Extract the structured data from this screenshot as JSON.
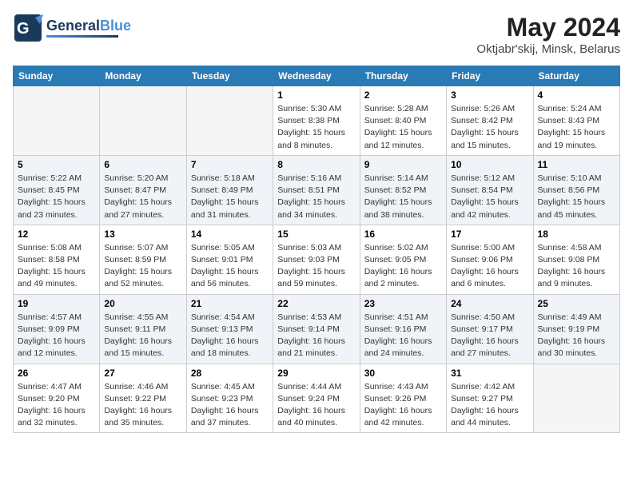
{
  "header": {
    "logo_line1": "General",
    "logo_line2": "Blue",
    "month_year": "May 2024",
    "location": "Oktjabr'skij, Minsk, Belarus"
  },
  "weekdays": [
    "Sunday",
    "Monday",
    "Tuesday",
    "Wednesday",
    "Thursday",
    "Friday",
    "Saturday"
  ],
  "weeks": [
    [
      {
        "day": "",
        "info": ""
      },
      {
        "day": "",
        "info": ""
      },
      {
        "day": "",
        "info": ""
      },
      {
        "day": "1",
        "info": "Sunrise: 5:30 AM\nSunset: 8:38 PM\nDaylight: 15 hours\nand 8 minutes."
      },
      {
        "day": "2",
        "info": "Sunrise: 5:28 AM\nSunset: 8:40 PM\nDaylight: 15 hours\nand 12 minutes."
      },
      {
        "day": "3",
        "info": "Sunrise: 5:26 AM\nSunset: 8:42 PM\nDaylight: 15 hours\nand 15 minutes."
      },
      {
        "day": "4",
        "info": "Sunrise: 5:24 AM\nSunset: 8:43 PM\nDaylight: 15 hours\nand 19 minutes."
      }
    ],
    [
      {
        "day": "5",
        "info": "Sunrise: 5:22 AM\nSunset: 8:45 PM\nDaylight: 15 hours\nand 23 minutes."
      },
      {
        "day": "6",
        "info": "Sunrise: 5:20 AM\nSunset: 8:47 PM\nDaylight: 15 hours\nand 27 minutes."
      },
      {
        "day": "7",
        "info": "Sunrise: 5:18 AM\nSunset: 8:49 PM\nDaylight: 15 hours\nand 31 minutes."
      },
      {
        "day": "8",
        "info": "Sunrise: 5:16 AM\nSunset: 8:51 PM\nDaylight: 15 hours\nand 34 minutes."
      },
      {
        "day": "9",
        "info": "Sunrise: 5:14 AM\nSunset: 8:52 PM\nDaylight: 15 hours\nand 38 minutes."
      },
      {
        "day": "10",
        "info": "Sunrise: 5:12 AM\nSunset: 8:54 PM\nDaylight: 15 hours\nand 42 minutes."
      },
      {
        "day": "11",
        "info": "Sunrise: 5:10 AM\nSunset: 8:56 PM\nDaylight: 15 hours\nand 45 minutes."
      }
    ],
    [
      {
        "day": "12",
        "info": "Sunrise: 5:08 AM\nSunset: 8:58 PM\nDaylight: 15 hours\nand 49 minutes."
      },
      {
        "day": "13",
        "info": "Sunrise: 5:07 AM\nSunset: 8:59 PM\nDaylight: 15 hours\nand 52 minutes."
      },
      {
        "day": "14",
        "info": "Sunrise: 5:05 AM\nSunset: 9:01 PM\nDaylight: 15 hours\nand 56 minutes."
      },
      {
        "day": "15",
        "info": "Sunrise: 5:03 AM\nSunset: 9:03 PM\nDaylight: 15 hours\nand 59 minutes."
      },
      {
        "day": "16",
        "info": "Sunrise: 5:02 AM\nSunset: 9:05 PM\nDaylight: 16 hours\nand 2 minutes."
      },
      {
        "day": "17",
        "info": "Sunrise: 5:00 AM\nSunset: 9:06 PM\nDaylight: 16 hours\nand 6 minutes."
      },
      {
        "day": "18",
        "info": "Sunrise: 4:58 AM\nSunset: 9:08 PM\nDaylight: 16 hours\nand 9 minutes."
      }
    ],
    [
      {
        "day": "19",
        "info": "Sunrise: 4:57 AM\nSunset: 9:09 PM\nDaylight: 16 hours\nand 12 minutes."
      },
      {
        "day": "20",
        "info": "Sunrise: 4:55 AM\nSunset: 9:11 PM\nDaylight: 16 hours\nand 15 minutes."
      },
      {
        "day": "21",
        "info": "Sunrise: 4:54 AM\nSunset: 9:13 PM\nDaylight: 16 hours\nand 18 minutes."
      },
      {
        "day": "22",
        "info": "Sunrise: 4:53 AM\nSunset: 9:14 PM\nDaylight: 16 hours\nand 21 minutes."
      },
      {
        "day": "23",
        "info": "Sunrise: 4:51 AM\nSunset: 9:16 PM\nDaylight: 16 hours\nand 24 minutes."
      },
      {
        "day": "24",
        "info": "Sunrise: 4:50 AM\nSunset: 9:17 PM\nDaylight: 16 hours\nand 27 minutes."
      },
      {
        "day": "25",
        "info": "Sunrise: 4:49 AM\nSunset: 9:19 PM\nDaylight: 16 hours\nand 30 minutes."
      }
    ],
    [
      {
        "day": "26",
        "info": "Sunrise: 4:47 AM\nSunset: 9:20 PM\nDaylight: 16 hours\nand 32 minutes."
      },
      {
        "day": "27",
        "info": "Sunrise: 4:46 AM\nSunset: 9:22 PM\nDaylight: 16 hours\nand 35 minutes."
      },
      {
        "day": "28",
        "info": "Sunrise: 4:45 AM\nSunset: 9:23 PM\nDaylight: 16 hours\nand 37 minutes."
      },
      {
        "day": "29",
        "info": "Sunrise: 4:44 AM\nSunset: 9:24 PM\nDaylight: 16 hours\nand 40 minutes."
      },
      {
        "day": "30",
        "info": "Sunrise: 4:43 AM\nSunset: 9:26 PM\nDaylight: 16 hours\nand 42 minutes."
      },
      {
        "day": "31",
        "info": "Sunrise: 4:42 AM\nSunset: 9:27 PM\nDaylight: 16 hours\nand 44 minutes."
      },
      {
        "day": "",
        "info": ""
      }
    ]
  ]
}
